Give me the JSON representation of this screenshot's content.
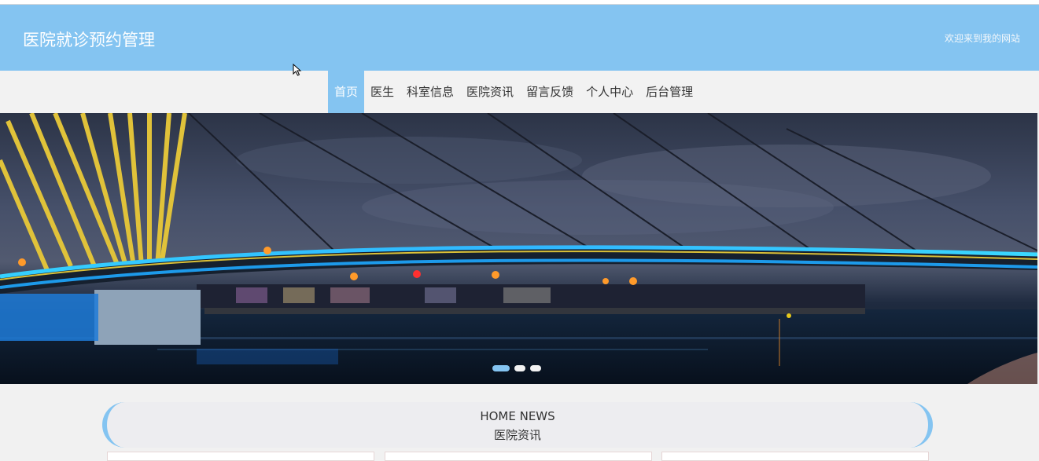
{
  "header": {
    "site_title": "医院就诊预约管理",
    "welcome_text": "欢迎来到我的网站"
  },
  "nav": {
    "items": [
      {
        "label": "首页",
        "active": true
      },
      {
        "label": "医生",
        "active": false
      },
      {
        "label": "科室信息",
        "active": false
      },
      {
        "label": "医院资讯",
        "active": false
      },
      {
        "label": "留言反馈",
        "active": false
      },
      {
        "label": "个人中心",
        "active": false
      },
      {
        "label": "后台管理",
        "active": false
      }
    ]
  },
  "banner": {
    "image_subject": "night bridge over river",
    "slide_count": 3,
    "active_slide": 1
  },
  "news_section": {
    "title_en": "HOME NEWS",
    "title_cn": "医院资讯"
  },
  "colors": {
    "accent": "#84c4f1",
    "background": "#f1f1f1",
    "text": "#333333"
  }
}
